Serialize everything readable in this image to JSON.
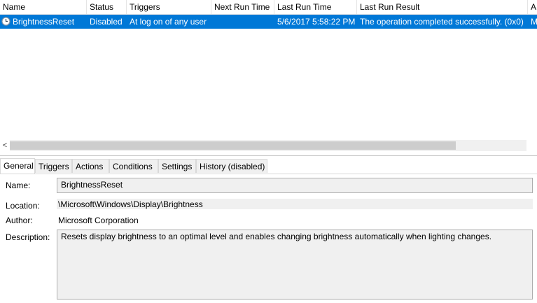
{
  "columns": {
    "name": "Name",
    "status": "Status",
    "triggers": "Triggers",
    "next_run_time": "Next Run Time",
    "last_run_time": "Last Run Time",
    "last_run_result": "Last Run Result",
    "author_partial": "A"
  },
  "task": {
    "name": "BrightnessReset",
    "status": "Disabled",
    "triggers": "At log on of any user",
    "next_run_time": "",
    "last_run_time": "5/6/2017 5:58:22 PM",
    "last_run_result": "The operation completed successfully. (0x0)",
    "author_partial": "M",
    "icon": "clock-icon"
  },
  "scrollbar": {
    "left_arrow": "<"
  },
  "tabs": [
    "General",
    "Triggers",
    "Actions",
    "Conditions",
    "Settings",
    "History (disabled)"
  ],
  "general": {
    "name_label": "Name:",
    "name_value": "BrightnessReset",
    "location_label": "Location:",
    "location_value": "\\Microsoft\\Windows\\Display\\Brightness",
    "author_label": "Author:",
    "author_value": "Microsoft Corporation",
    "description_label": "Description:",
    "description_value": "Resets display brightness to an optimal level and enables changing brightness automatically when lighting changes."
  },
  "colors": {
    "selection": "#0078d7",
    "field_bg": "#f0f0f0"
  }
}
